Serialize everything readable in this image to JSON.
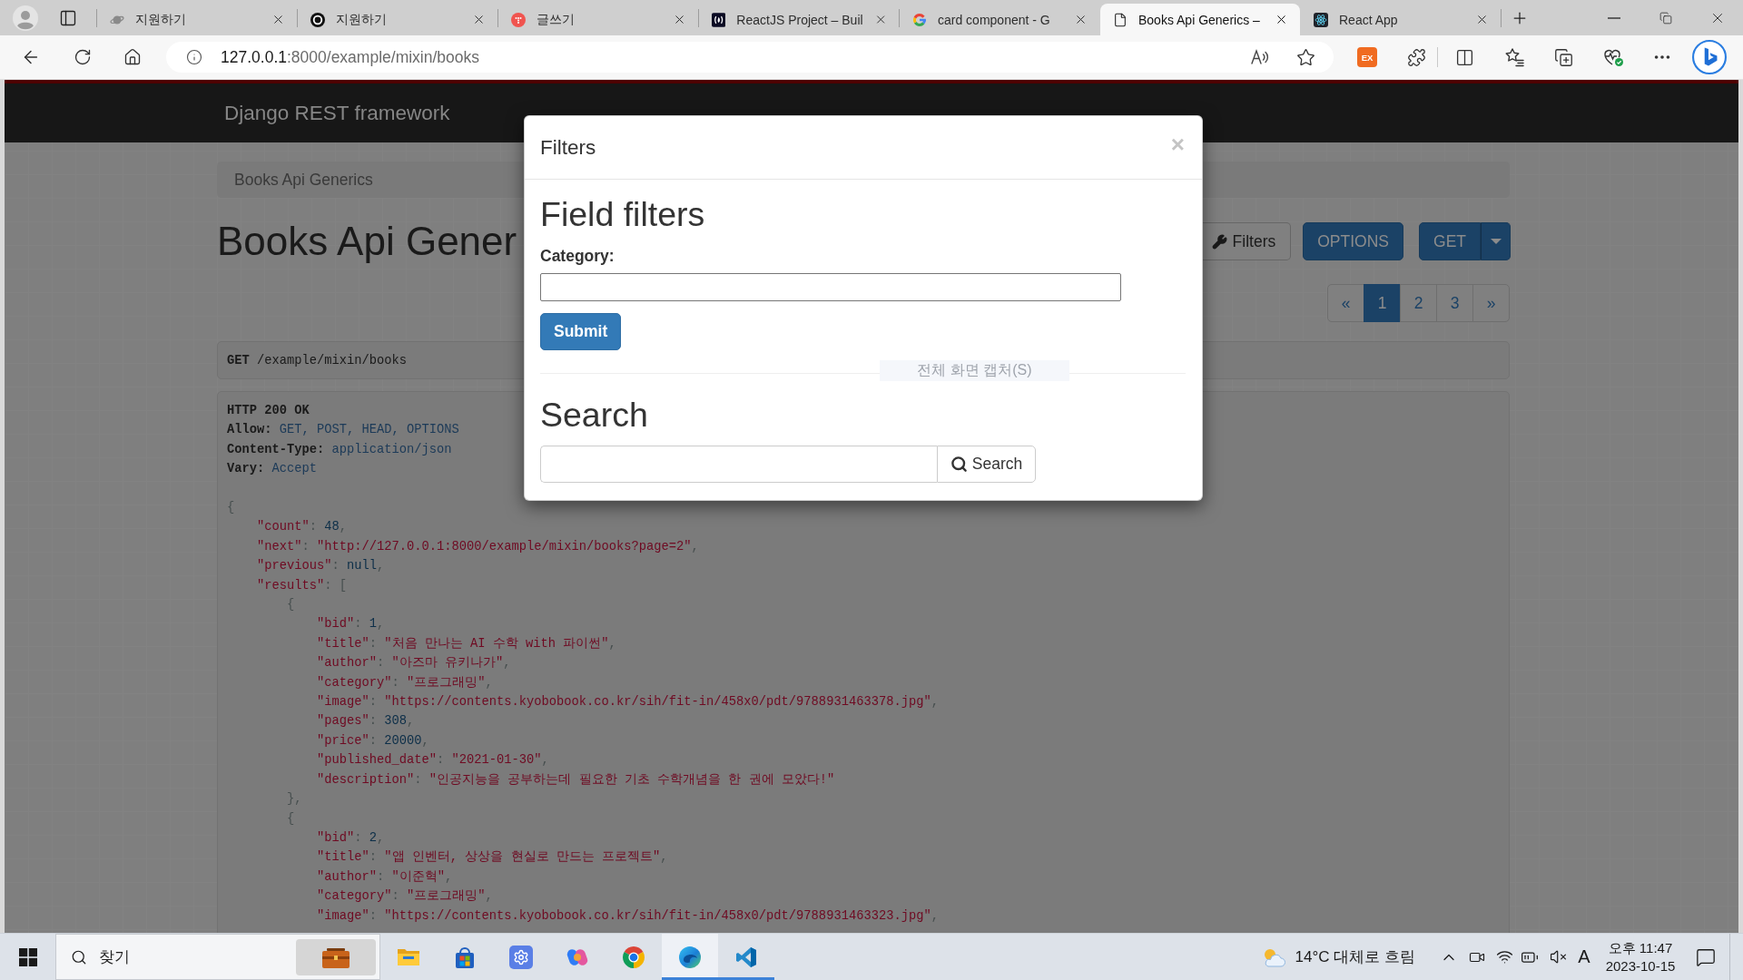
{
  "browser": {
    "tabs": [
      {
        "title": "지원하기",
        "selected": false
      },
      {
        "title": "지원하기",
        "selected": false
      },
      {
        "title": "글쓰기",
        "selected": false
      },
      {
        "title": "ReactJS Project – Buil",
        "selected": false
      },
      {
        "title": "card component - G",
        "selected": false
      },
      {
        "title": "Books Api Generics –",
        "selected": true
      },
      {
        "title": "React App",
        "selected": false
      }
    ],
    "address": {
      "host": "127.0.0.1",
      "rest": ":8000/example/mixin/books"
    },
    "extension_label": "EX"
  },
  "page": {
    "brand": "Django REST framework",
    "breadcrumb": [
      {
        "label": "Books Api Generics"
      }
    ],
    "heading": "Books Api Gener",
    "actions": [
      {
        "kind": "filters",
        "label": "Filters"
      },
      {
        "kind": "primary",
        "label": "OPTIONS"
      },
      {
        "kind": "split",
        "label": "GET"
      }
    ],
    "pagination": [
      {
        "label": "«",
        "selected": false
      },
      {
        "label": "1",
        "selected": true
      },
      {
        "label": "2",
        "selected": false
      },
      {
        "label": "3",
        "selected": false
      },
      {
        "label": "»",
        "selected": false
      }
    ],
    "request": {
      "method": "GET",
      "path": "/example/mixin/books"
    },
    "response": {
      "status": "HTTP 200 OK",
      "headers": [
        {
          "name": "Allow:",
          "value": "GET, POST, HEAD, OPTIONS"
        },
        {
          "name": "Content-Type:",
          "value": "application/json"
        },
        {
          "name": "Vary:",
          "value": "Accept"
        }
      ],
      "body": [
        {
          "tokens": [
            {
              "kind": "punct",
              "text": "{"
            }
          ],
          "children": [
            {
              "tokens": [
                {
                  "kind": "key",
                  "text": "\"count\""
                },
                {
                  "kind": "punct",
                  "text": ": "
                },
                {
                  "kind": "number",
                  "text": "48"
                },
                {
                  "kind": "punct",
                  "text": ","
                }
              ]
            },
            {
              "tokens": [
                {
                  "kind": "key",
                  "text": "\"next\""
                },
                {
                  "kind": "punct",
                  "text": ": "
                },
                {
                  "kind": "string",
                  "text": "\"http://127.0.0.1:8000/example/mixin/books?page=2\""
                },
                {
                  "kind": "punct",
                  "text": ","
                }
              ]
            },
            {
              "tokens": [
                {
                  "kind": "key",
                  "text": "\"previous\""
                },
                {
                  "kind": "punct",
                  "text": ": "
                },
                {
                  "kind": "number",
                  "text": "null"
                },
                {
                  "kind": "punct",
                  "text": ","
                }
              ]
            },
            {
              "tokens": [
                {
                  "kind": "key",
                  "text": "\"results\""
                },
                {
                  "kind": "punct",
                  "text": ": ["
                }
              ],
              "children": [
                {
                  "tokens": [
                    {
                      "kind": "punct",
                      "text": "{"
                    }
                  ],
                  "children": [
                    {
                      "tokens": [
                        {
                          "kind": "key",
                          "text": "\"bid\""
                        },
                        {
                          "kind": "punct",
                          "text": ": "
                        },
                        {
                          "kind": "number",
                          "text": "1"
                        },
                        {
                          "kind": "punct",
                          "text": ","
                        }
                      ]
                    },
                    {
                      "tokens": [
                        {
                          "kind": "key",
                          "text": "\"title\""
                        },
                        {
                          "kind": "punct",
                          "text": ": "
                        },
                        {
                          "kind": "string",
                          "text": "\"처음 만나는 AI 수학 with 파이썬\""
                        },
                        {
                          "kind": "punct",
                          "text": ","
                        }
                      ]
                    },
                    {
                      "tokens": [
                        {
                          "kind": "key",
                          "text": "\"author\""
                        },
                        {
                          "kind": "punct",
                          "text": ": "
                        },
                        {
                          "kind": "string",
                          "text": "\"아즈마 유키나가\""
                        },
                        {
                          "kind": "punct",
                          "text": ","
                        }
                      ]
                    },
                    {
                      "tokens": [
                        {
                          "kind": "key",
                          "text": "\"category\""
                        },
                        {
                          "kind": "punct",
                          "text": ": "
                        },
                        {
                          "kind": "string",
                          "text": "\"프로그래밍\""
                        },
                        {
                          "kind": "punct",
                          "text": ","
                        }
                      ]
                    },
                    {
                      "tokens": [
                        {
                          "kind": "key",
                          "text": "\"image\""
                        },
                        {
                          "kind": "punct",
                          "text": ": "
                        },
                        {
                          "kind": "string",
                          "text": "\"https://contents.kyobobook.co.kr/sih/fit-in/458x0/pdt/9788931463378.jpg\""
                        },
                        {
                          "kind": "punct",
                          "text": ","
                        }
                      ]
                    },
                    {
                      "tokens": [
                        {
                          "kind": "key",
                          "text": "\"pages\""
                        },
                        {
                          "kind": "punct",
                          "text": ": "
                        },
                        {
                          "kind": "number",
                          "text": "308"
                        },
                        {
                          "kind": "punct",
                          "text": ","
                        }
                      ]
                    },
                    {
                      "tokens": [
                        {
                          "kind": "key",
                          "text": "\"price\""
                        },
                        {
                          "kind": "punct",
                          "text": ": "
                        },
                        {
                          "kind": "number",
                          "text": "20000"
                        },
                        {
                          "kind": "punct",
                          "text": ","
                        }
                      ]
                    },
                    {
                      "tokens": [
                        {
                          "kind": "key",
                          "text": "\"published_date\""
                        },
                        {
                          "kind": "punct",
                          "text": ": "
                        },
                        {
                          "kind": "string",
                          "text": "\"2021-01-30\""
                        },
                        {
                          "kind": "punct",
                          "text": ","
                        }
                      ]
                    },
                    {
                      "tokens": [
                        {
                          "kind": "key",
                          "text": "\"description\""
                        },
                        {
                          "kind": "punct",
                          "text": ": "
                        },
                        {
                          "kind": "string",
                          "text": "\"인공지능을 공부하는데 필요한 기초 수학개념을 한 권에 모았다!\""
                        }
                      ]
                    }
                  ]
                },
                {
                  "tokens": [
                    {
                      "kind": "punct",
                      "text": "},"
                    }
                  ]
                },
                {
                  "tokens": [
                    {
                      "kind": "punct",
                      "text": "{"
                    }
                  ],
                  "children": [
                    {
                      "tokens": [
                        {
                          "kind": "key",
                          "text": "\"bid\""
                        },
                        {
                          "kind": "punct",
                          "text": ": "
                        },
                        {
                          "kind": "number",
                          "text": "2"
                        },
                        {
                          "kind": "punct",
                          "text": ","
                        }
                      ]
                    },
                    {
                      "tokens": [
                        {
                          "kind": "key",
                          "text": "\"title\""
                        },
                        {
                          "kind": "punct",
                          "text": ": "
                        },
                        {
                          "kind": "string",
                          "text": "\"앱 인벤터, 상상을 현실로 만드는 프로젝트\""
                        },
                        {
                          "kind": "punct",
                          "text": ","
                        }
                      ]
                    },
                    {
                      "tokens": [
                        {
                          "kind": "key",
                          "text": "\"author\""
                        },
                        {
                          "kind": "punct",
                          "text": ": "
                        },
                        {
                          "kind": "string",
                          "text": "\"이준혁\""
                        },
                        {
                          "kind": "punct",
                          "text": ","
                        }
                      ]
                    },
                    {
                      "tokens": [
                        {
                          "kind": "key",
                          "text": "\"category\""
                        },
                        {
                          "kind": "punct",
                          "text": ": "
                        },
                        {
                          "kind": "string",
                          "text": "\"프로그래밍\""
                        },
                        {
                          "kind": "punct",
                          "text": ","
                        }
                      ]
                    },
                    {
                      "tokens": [
                        {
                          "kind": "key",
                          "text": "\"image\""
                        },
                        {
                          "kind": "punct",
                          "text": ": "
                        },
                        {
                          "kind": "string",
                          "text": "\"https://contents.kyobobook.co.kr/sih/fit-in/458x0/pdt/9788931463323.jpg\""
                        },
                        {
                          "kind": "punct",
                          "text": ","
                        }
                      ]
                    }
                  ]
                }
              ]
            }
          ]
        }
      ]
    }
  },
  "modal": {
    "title": "Filters",
    "close": "×",
    "sections": [
      {
        "kind": "field_filters",
        "heading": "Field filters",
        "label": "Category:",
        "button": "Submit"
      },
      {
        "kind": "search",
        "heading": "Search",
        "button": "Search"
      }
    ]
  },
  "screen_tip": "전체 화면 캡처(S)",
  "taskbar": {
    "placeholder": "찾기",
    "apps": [
      {
        "running": false,
        "active": false
      },
      {
        "running": false,
        "active": false
      },
      {
        "running": false,
        "active": false
      },
      {
        "running": false,
        "active": false
      },
      {
        "running": false,
        "active": false
      },
      {
        "running": true,
        "active": true
      },
      {
        "running": true,
        "active": false
      }
    ],
    "weather": "14°C 대체로 흐림",
    "ime": "A",
    "time": "오후 11:47",
    "date": "2023-10-15"
  }
}
